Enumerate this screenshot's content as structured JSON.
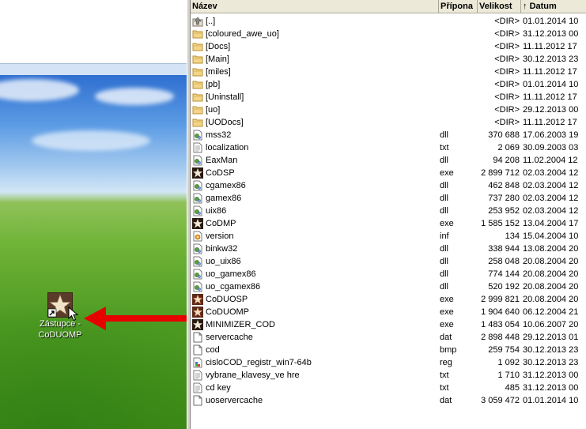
{
  "desktop": {
    "shortcut": {
      "icon": "codmp-star-icon",
      "label_line1": "Zástupce -",
      "label_line2": "CoDUOMP"
    },
    "arrow_color": "#e60000"
  },
  "panel": {
    "columns": {
      "name": "Název",
      "ext": "Přípona",
      "size": "Velikost",
      "date": "Datum",
      "sort_indicator": "↑"
    },
    "files": [
      {
        "name": "[..]",
        "ext": "",
        "size": "<DIR>",
        "date": "01.01.2014 10",
        "icon": "up-dir-icon"
      },
      {
        "name": "[coloured_awe_uo]",
        "ext": "",
        "size": "<DIR>",
        "date": "31.12.2013 00",
        "icon": "folder-icon"
      },
      {
        "name": "[Docs]",
        "ext": "",
        "size": "<DIR>",
        "date": "11.11.2012 17",
        "icon": "folder-icon"
      },
      {
        "name": "[Main]",
        "ext": "",
        "size": "<DIR>",
        "date": "30.12.2013 23",
        "icon": "folder-icon"
      },
      {
        "name": "[miles]",
        "ext": "",
        "size": "<DIR>",
        "date": "11.11.2012 17",
        "icon": "folder-icon"
      },
      {
        "name": "[pb]",
        "ext": "",
        "size": "<DIR>",
        "date": "01.01.2014 10",
        "icon": "folder-icon"
      },
      {
        "name": "[Uninstall]",
        "ext": "",
        "size": "<DIR>",
        "date": "11.11.2012 17",
        "icon": "folder-icon"
      },
      {
        "name": "[uo]",
        "ext": "",
        "size": "<DIR>",
        "date": "29.12.2013 00",
        "icon": "folder-icon"
      },
      {
        "name": "[UODocs]",
        "ext": "",
        "size": "<DIR>",
        "date": "11.11.2012 17",
        "icon": "folder-icon"
      },
      {
        "name": "mss32",
        "ext": "dll",
        "size": "370 688",
        "date": "17.06.2003 19",
        "icon": "dll-icon"
      },
      {
        "name": "localization",
        "ext": "txt",
        "size": "2 069",
        "date": "30.09.2003 03",
        "icon": "text-file-icon"
      },
      {
        "name": "EaxMan",
        "ext": "dll",
        "size": "94 208",
        "date": "11.02.2004 12",
        "icon": "dll-icon"
      },
      {
        "name": "CoDSP",
        "ext": "exe",
        "size": "2 899 712",
        "date": "02.03.2004 12",
        "icon": "cod-star-icon"
      },
      {
        "name": "cgamex86",
        "ext": "dll",
        "size": "462 848",
        "date": "02.03.2004 12",
        "icon": "dll-icon"
      },
      {
        "name": "gamex86",
        "ext": "dll",
        "size": "737 280",
        "date": "02.03.2004 12",
        "icon": "dll-icon"
      },
      {
        "name": "uix86",
        "ext": "dll",
        "size": "253 952",
        "date": "02.03.2004 12",
        "icon": "dll-icon"
      },
      {
        "name": "CoDMP",
        "ext": "exe",
        "size": "1 585 152",
        "date": "13.04.2004 17",
        "icon": "cod-star-icon"
      },
      {
        "name": "version",
        "ext": "inf",
        "size": "134",
        "date": "15.04.2004 10",
        "icon": "inf-file-icon"
      },
      {
        "name": "binkw32",
        "ext": "dll",
        "size": "338 944",
        "date": "13.08.2004 20",
        "icon": "dll-icon"
      },
      {
        "name": "uo_uix86",
        "ext": "dll",
        "size": "258 048",
        "date": "20.08.2004 20",
        "icon": "dll-icon"
      },
      {
        "name": "uo_gamex86",
        "ext": "dll",
        "size": "774 144",
        "date": "20.08.2004 20",
        "icon": "dll-icon"
      },
      {
        "name": "uo_cgamex86",
        "ext": "dll",
        "size": "520 192",
        "date": "20.08.2004 20",
        "icon": "dll-icon"
      },
      {
        "name": "CoDUOSP",
        "ext": "exe",
        "size": "2 999 821",
        "date": "20.08.2004 20",
        "icon": "coduo-star-icon"
      },
      {
        "name": "CoDUOMP",
        "ext": "exe",
        "size": "1 904 640",
        "date": "06.12.2004 21",
        "icon": "coduo-star-icon"
      },
      {
        "name": "MINIMIZER_COD",
        "ext": "exe",
        "size": "1 483 054",
        "date": "10.06.2007 20",
        "icon": "cod-star-icon"
      },
      {
        "name": "servercache",
        "ext": "dat",
        "size": "2 898 448",
        "date": "29.12.2013 01",
        "icon": "file-icon"
      },
      {
        "name": "cod",
        "ext": "bmp",
        "size": "259 754",
        "date": "30.12.2013 23",
        "icon": "file-icon"
      },
      {
        "name": "cisloCOD_registr_win7-64b",
        "ext": "reg",
        "size": "1 092",
        "date": "30.12.2013 23",
        "icon": "reg-file-icon"
      },
      {
        "name": "vybrane_klavesy_ve hre",
        "ext": "txt",
        "size": "1 710",
        "date": "31.12.2013 00",
        "icon": "text-file-icon"
      },
      {
        "name": "cd key",
        "ext": "txt",
        "size": "485",
        "date": "31.12.2013 00",
        "icon": "text-file-icon"
      },
      {
        "name": "uoservercache",
        "ext": "dat",
        "size": "3 059 472",
        "date": "01.01.2014 10",
        "icon": "file-icon"
      }
    ]
  }
}
